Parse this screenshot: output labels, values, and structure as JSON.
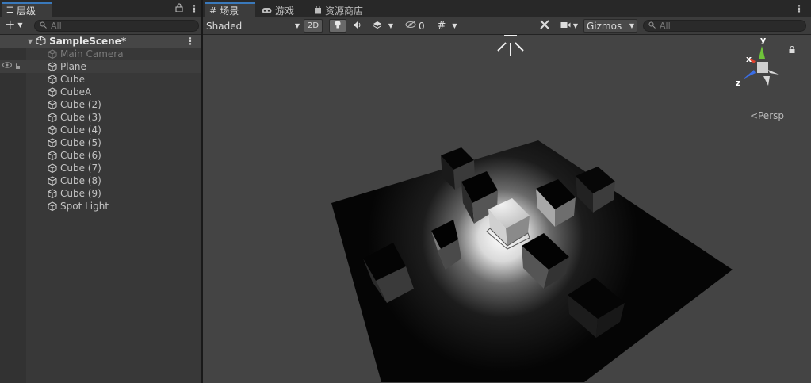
{
  "hierarchy": {
    "tab_label": "层级",
    "search_placeholder": "All",
    "scene_name": "SampleScene*",
    "items": [
      {
        "label": "Main Camera",
        "state": "disabled"
      },
      {
        "label": "Plane",
        "state": "hovered"
      },
      {
        "label": "Cube",
        "state": "normal"
      },
      {
        "label": "CubeA",
        "state": "normal"
      },
      {
        "label": "Cube (2)",
        "state": "normal"
      },
      {
        "label": "Cube (3)",
        "state": "normal"
      },
      {
        "label": "Cube (4)",
        "state": "normal"
      },
      {
        "label": "Cube (5)",
        "state": "normal"
      },
      {
        "label": "Cube (6)",
        "state": "normal"
      },
      {
        "label": "Cube (7)",
        "state": "normal"
      },
      {
        "label": "Cube (8)",
        "state": "normal"
      },
      {
        "label": "Cube (9)",
        "state": "normal"
      },
      {
        "label": "Spot Light",
        "state": "normal"
      }
    ]
  },
  "tabs": {
    "scene": "场景",
    "game": "游戏",
    "asset_store": "资源商店"
  },
  "scene_toolbar": {
    "draw_mode": "Shaded",
    "mode_2d": "2D",
    "hidden_count": "0",
    "gizmos": "Gizmos",
    "search_placeholder": "All"
  },
  "gizmo": {
    "x_label": "x",
    "y_label": "y",
    "z_label": "z",
    "projection": "Persp"
  },
  "colors": {
    "accent_tab": "#3a79bb",
    "x_axis": "#e0402b",
    "y_axis": "#6fc33a",
    "z_axis": "#3a6ee6"
  }
}
